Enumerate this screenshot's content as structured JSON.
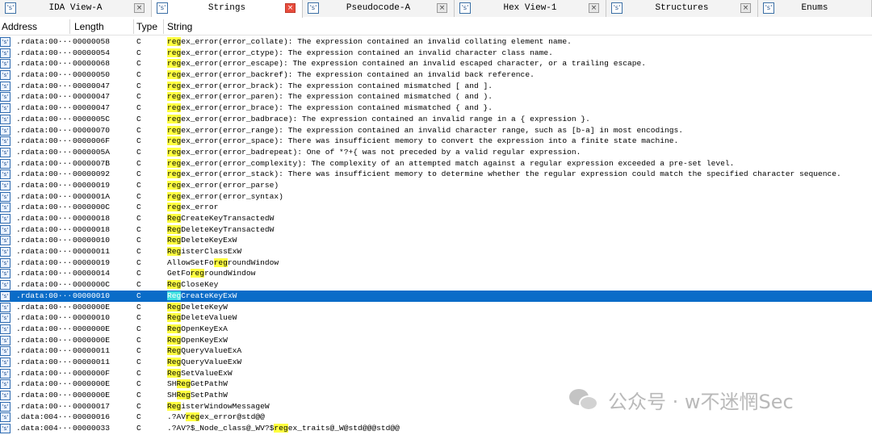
{
  "tabs": [
    {
      "label": "IDA View-A",
      "icon": "ida-view-icon",
      "active": false
    },
    {
      "label": "Strings",
      "icon": "strings-icon",
      "active": true
    },
    {
      "label": "Pseudocode-A",
      "icon": "pseudocode-icon",
      "active": false
    },
    {
      "label": "Hex View-1",
      "icon": "hex-view-icon",
      "active": false
    },
    {
      "label": "Structures",
      "icon": "structures-icon",
      "active": false
    },
    {
      "label": "Enums",
      "icon": "enums-icon",
      "active": false
    }
  ],
  "close_glyph": "×",
  "icon_glyph": "'s'",
  "columns": {
    "address": "Address",
    "length": "Length",
    "type": "Type",
    "string": "String"
  },
  "highlight_color": "#ffff40",
  "selection_color": "#0a6cc8",
  "rows": [
    {
      "addr": ".rdata:00···",
      "len": "00000058",
      "type": "C",
      "pre": "",
      "hl": "reg",
      "post": "ex_error(error_collate): The expression contained an invalid collating element name."
    },
    {
      "addr": ".rdata:00···",
      "len": "00000054",
      "type": "C",
      "pre": "",
      "hl": "reg",
      "post": "ex_error(error_ctype): The expression contained an invalid character class name."
    },
    {
      "addr": ".rdata:00···",
      "len": "00000068",
      "type": "C",
      "pre": "",
      "hl": "reg",
      "post": "ex_error(error_escape): The expression contained an invalid escaped character, or a trailing escape."
    },
    {
      "addr": ".rdata:00···",
      "len": "00000050",
      "type": "C",
      "pre": "",
      "hl": "reg",
      "post": "ex_error(error_backref): The expression contained an invalid back reference."
    },
    {
      "addr": ".rdata:00···",
      "len": "00000047",
      "type": "C",
      "pre": "",
      "hl": "reg",
      "post": "ex_error(error_brack): The expression contained mismatched [ and ]."
    },
    {
      "addr": ".rdata:00···",
      "len": "00000047",
      "type": "C",
      "pre": "",
      "hl": "reg",
      "post": "ex_error(error_paren): The expression contained mismatched ( and )."
    },
    {
      "addr": ".rdata:00···",
      "len": "00000047",
      "type": "C",
      "pre": "",
      "hl": "reg",
      "post": "ex_error(error_brace): The expression contained mismatched { and }."
    },
    {
      "addr": ".rdata:00···",
      "len": "0000005C",
      "type": "C",
      "pre": "",
      "hl": "reg",
      "post": "ex_error(error_badbrace): The expression contained an invalid range in a { expression }."
    },
    {
      "addr": ".rdata:00···",
      "len": "00000070",
      "type": "C",
      "pre": "",
      "hl": "reg",
      "post": "ex_error(error_range): The expression contained an invalid character range, such as [b-a] in most encodings."
    },
    {
      "addr": ".rdata:00···",
      "len": "0000006F",
      "type": "C",
      "pre": "",
      "hl": "reg",
      "post": "ex_error(error_space): There was insufficient memory to convert the expression into a finite state machine."
    },
    {
      "addr": ".rdata:00···",
      "len": "0000005A",
      "type": "C",
      "pre": "",
      "hl": "reg",
      "post": "ex_error(error_badrepeat): One of *?+{ was not preceded by a valid regular expression."
    },
    {
      "addr": ".rdata:00···",
      "len": "0000007B",
      "type": "C",
      "pre": "",
      "hl": "reg",
      "post": "ex_error(error_complexity): The complexity of an attempted match against a regular expression exceeded a pre-set level."
    },
    {
      "addr": ".rdata:00···",
      "len": "00000092",
      "type": "C",
      "pre": "",
      "hl": "reg",
      "post": "ex_error(error_stack): There was insufficient memory to determine whether the regular expression could match the specified character sequence."
    },
    {
      "addr": ".rdata:00···",
      "len": "00000019",
      "type": "C",
      "pre": "",
      "hl": "reg",
      "post": "ex_error(error_parse)"
    },
    {
      "addr": ".rdata:00···",
      "len": "0000001A",
      "type": "C",
      "pre": "",
      "hl": "reg",
      "post": "ex_error(error_syntax)"
    },
    {
      "addr": ".rdata:00···",
      "len": "0000000C",
      "type": "C",
      "pre": "",
      "hl": "reg",
      "post": "ex_error"
    },
    {
      "addr": ".rdata:00···",
      "len": "00000018",
      "type": "C",
      "pre": "",
      "hl": "Reg",
      "post": "CreateKeyTransactedW"
    },
    {
      "addr": ".rdata:00···",
      "len": "00000018",
      "type": "C",
      "pre": "",
      "hl": "Reg",
      "post": "DeleteKeyTransactedW"
    },
    {
      "addr": ".rdata:00···",
      "len": "00000010",
      "type": "C",
      "pre": "",
      "hl": "Reg",
      "post": "DeleteKeyExW"
    },
    {
      "addr": ".rdata:00···",
      "len": "00000011",
      "type": "C",
      "pre": "",
      "hl": "Reg",
      "post": "isterClassExW"
    },
    {
      "addr": ".rdata:00···",
      "len": "00000019",
      "type": "C",
      "pre": "AllowSetFo",
      "hl": "reg",
      "post": "roundWindow"
    },
    {
      "addr": ".rdata:00···",
      "len": "00000014",
      "type": "C",
      "pre": "GetFo",
      "hl": "reg",
      "post": "roundWindow"
    },
    {
      "addr": ".rdata:00···",
      "len": "0000000C",
      "type": "C",
      "pre": "",
      "hl": "Reg",
      "post": "CloseKey"
    },
    {
      "addr": ".rdata:00···",
      "len": "00000010",
      "type": "C",
      "pre": "",
      "hl": "Reg",
      "post": "CreateKeyExW",
      "selected": true
    },
    {
      "addr": ".rdata:00···",
      "len": "0000000E",
      "type": "C",
      "pre": "",
      "hl": "Reg",
      "post": "DeleteKeyW"
    },
    {
      "addr": ".rdata:00···",
      "len": "00000010",
      "type": "C",
      "pre": "",
      "hl": "Reg",
      "post": "DeleteValueW"
    },
    {
      "addr": ".rdata:00···",
      "len": "0000000E",
      "type": "C",
      "pre": "",
      "hl": "Reg",
      "post": "OpenKeyExA"
    },
    {
      "addr": ".rdata:00···",
      "len": "0000000E",
      "type": "C",
      "pre": "",
      "hl": "Reg",
      "post": "OpenKeyExW"
    },
    {
      "addr": ".rdata:00···",
      "len": "00000011",
      "type": "C",
      "pre": "",
      "hl": "Reg",
      "post": "QueryValueExA"
    },
    {
      "addr": ".rdata:00···",
      "len": "00000011",
      "type": "C",
      "pre": "",
      "hl": "Reg",
      "post": "QueryValueExW"
    },
    {
      "addr": ".rdata:00···",
      "len": "0000000F",
      "type": "C",
      "pre": "",
      "hl": "Reg",
      "post": "SetValueExW"
    },
    {
      "addr": ".rdata:00···",
      "len": "0000000E",
      "type": "C",
      "pre": "SH",
      "hl": "Reg",
      "post": "GetPathW"
    },
    {
      "addr": ".rdata:00···",
      "len": "0000000E",
      "type": "C",
      "pre": "SH",
      "hl": "Reg",
      "post": "SetPathW"
    },
    {
      "addr": ".rdata:00···",
      "len": "00000017",
      "type": "C",
      "pre": "",
      "hl": "Reg",
      "post": "isterWindowMessageW"
    },
    {
      "addr": ".data:004···",
      "len": "00000016",
      "type": "C",
      "pre": ".?AV",
      "hl": "reg",
      "post": "ex_error@std@@"
    },
    {
      "addr": ".data:004···",
      "len": "00000033",
      "type": "C",
      "pre": ".?AV?$_Node_class@_WV?$",
      "hl": "reg",
      "post": "ex_traits@_W@std@@@std@@"
    }
  ],
  "watermark": {
    "text": "公众号 · w不迷惘Sec",
    "icon": "wechat-logo-icon"
  }
}
